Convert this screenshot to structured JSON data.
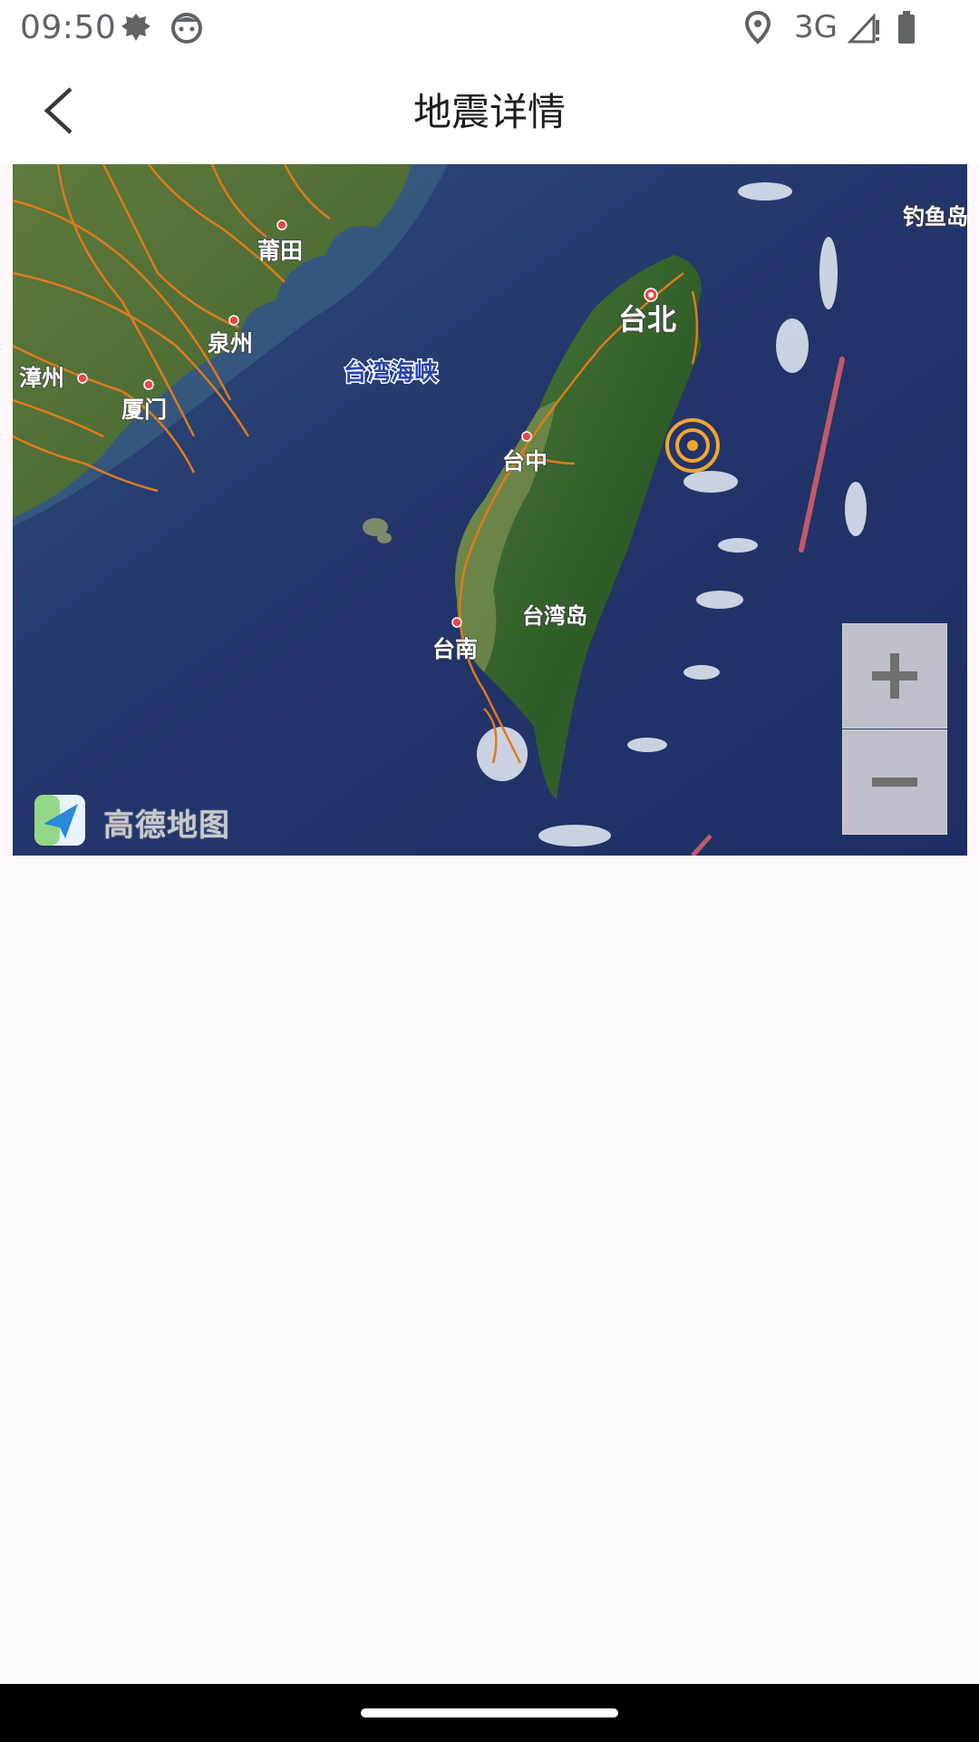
{
  "status_bar": {
    "time": "09:50",
    "network": "3G",
    "icons": [
      "gear-notification-icon",
      "cat-face-icon",
      "location-icon",
      "signal-icon",
      "battery-icon"
    ]
  },
  "app_bar": {
    "title": "地震详情",
    "back_icon": "chevron-left-icon"
  },
  "map": {
    "labels": {
      "putian": "莆田",
      "quanzhou": "泉州",
      "zhangzhou": "漳州",
      "xiamen": "厦门",
      "strait": "台湾海峡",
      "taipei": "台北",
      "taichung": "台中",
      "tainan": "台南",
      "island": "台湾岛",
      "diaoyu": "钓鱼岛"
    },
    "logo_text": "高德地图",
    "zoom_in_icon": "plus-icon",
    "zoom_out_icon": "minus-icon",
    "epicenter_icon": "epicenter-marker-icon"
  }
}
